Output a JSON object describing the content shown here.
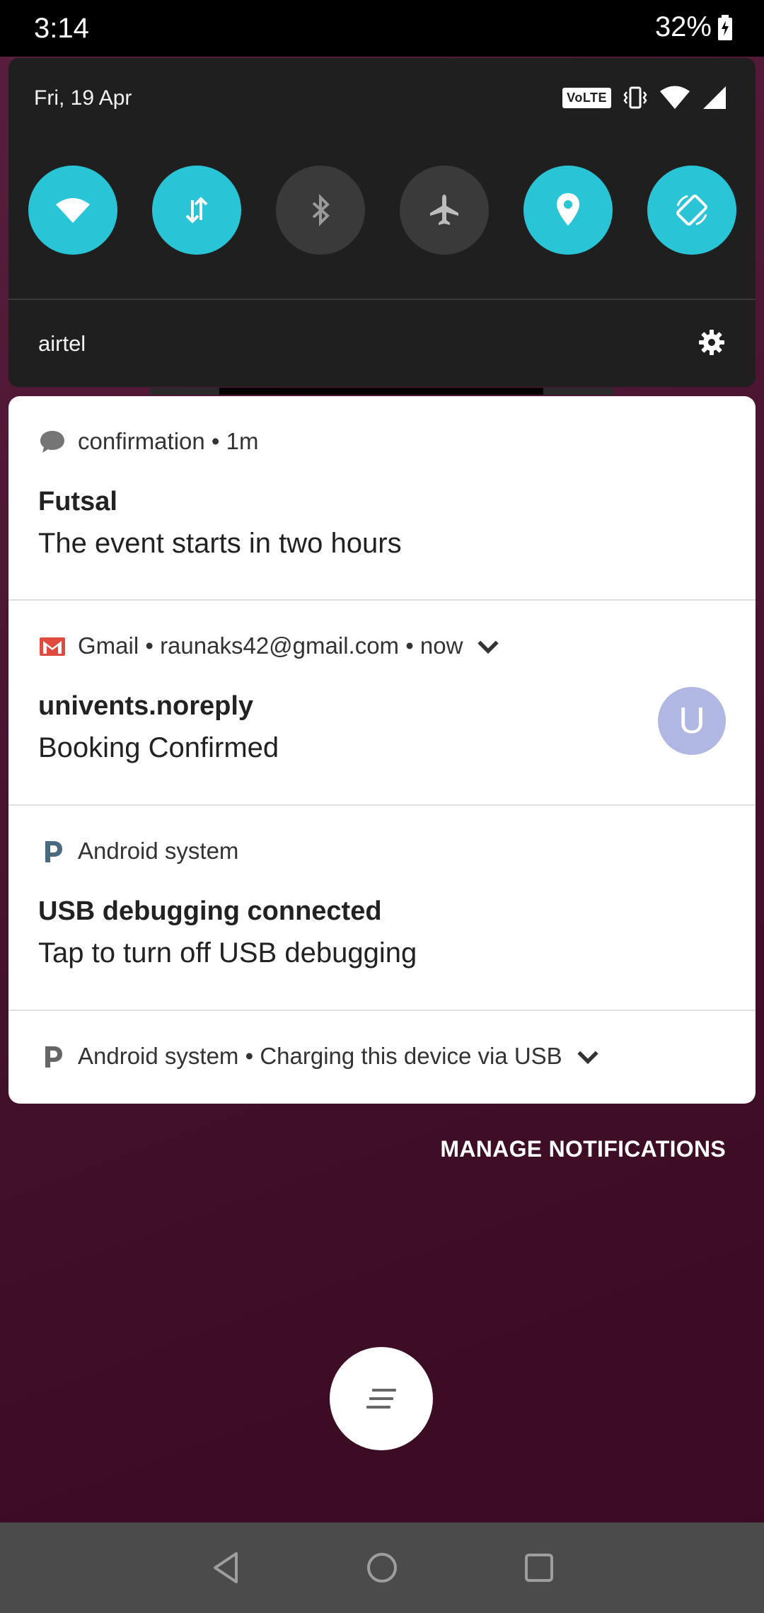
{
  "status_bar": {
    "time": "3:14",
    "battery_percent": "32%",
    "battery_icon": "battery-charging-icon"
  },
  "quick_settings": {
    "date": "Fri, 19 Apr",
    "volte_badge": "VoLTE",
    "system_icons": [
      "volte-icon",
      "vibrate-icon",
      "wifi-signal-icon",
      "cell-signal-icon"
    ],
    "tiles": [
      {
        "name": "wifi",
        "icon": "wifi-icon",
        "state": "on"
      },
      {
        "name": "mobile-data",
        "icon": "data-arrows-icon",
        "state": "on"
      },
      {
        "name": "bluetooth",
        "icon": "bluetooth-icon",
        "state": "off"
      },
      {
        "name": "airplane-mode",
        "icon": "airplane-icon",
        "state": "off"
      },
      {
        "name": "location",
        "icon": "location-pin-icon",
        "state": "on"
      },
      {
        "name": "auto-rotate",
        "icon": "rotate-icon",
        "state": "on"
      }
    ],
    "carrier": "airtel",
    "settings_icon": "gear-icon",
    "accent_color": "#29c4d6"
  },
  "notifications": [
    {
      "app": "confirmation • 1m",
      "icon": "chat-bubble-icon",
      "title": "Futsal",
      "text": "The event starts in two hours"
    },
    {
      "app": "Gmail • raunaks42@gmail.com • now",
      "icon": "gmail-icon",
      "expand_icon": "chevron-down-icon",
      "title": "univents.noreply",
      "text": "Booking Confirmed",
      "avatar_letter": "U",
      "avatar_color": "#b1b7e3"
    },
    {
      "app": "Android system",
      "icon": "android-system-icon",
      "title": "USB debugging connected",
      "text": "Tap to turn off USB debugging"
    },
    {
      "app": "Android system • Charging this device via USB",
      "icon": "android-system-icon",
      "expand_icon": "chevron-down-icon"
    }
  ],
  "manage_notifications": "MANAGE NOTIFICATIONS",
  "clear_all_icon": "clear-all-icon",
  "nav_bar": {
    "buttons": [
      "back-icon",
      "home-icon",
      "recents-icon"
    ]
  }
}
